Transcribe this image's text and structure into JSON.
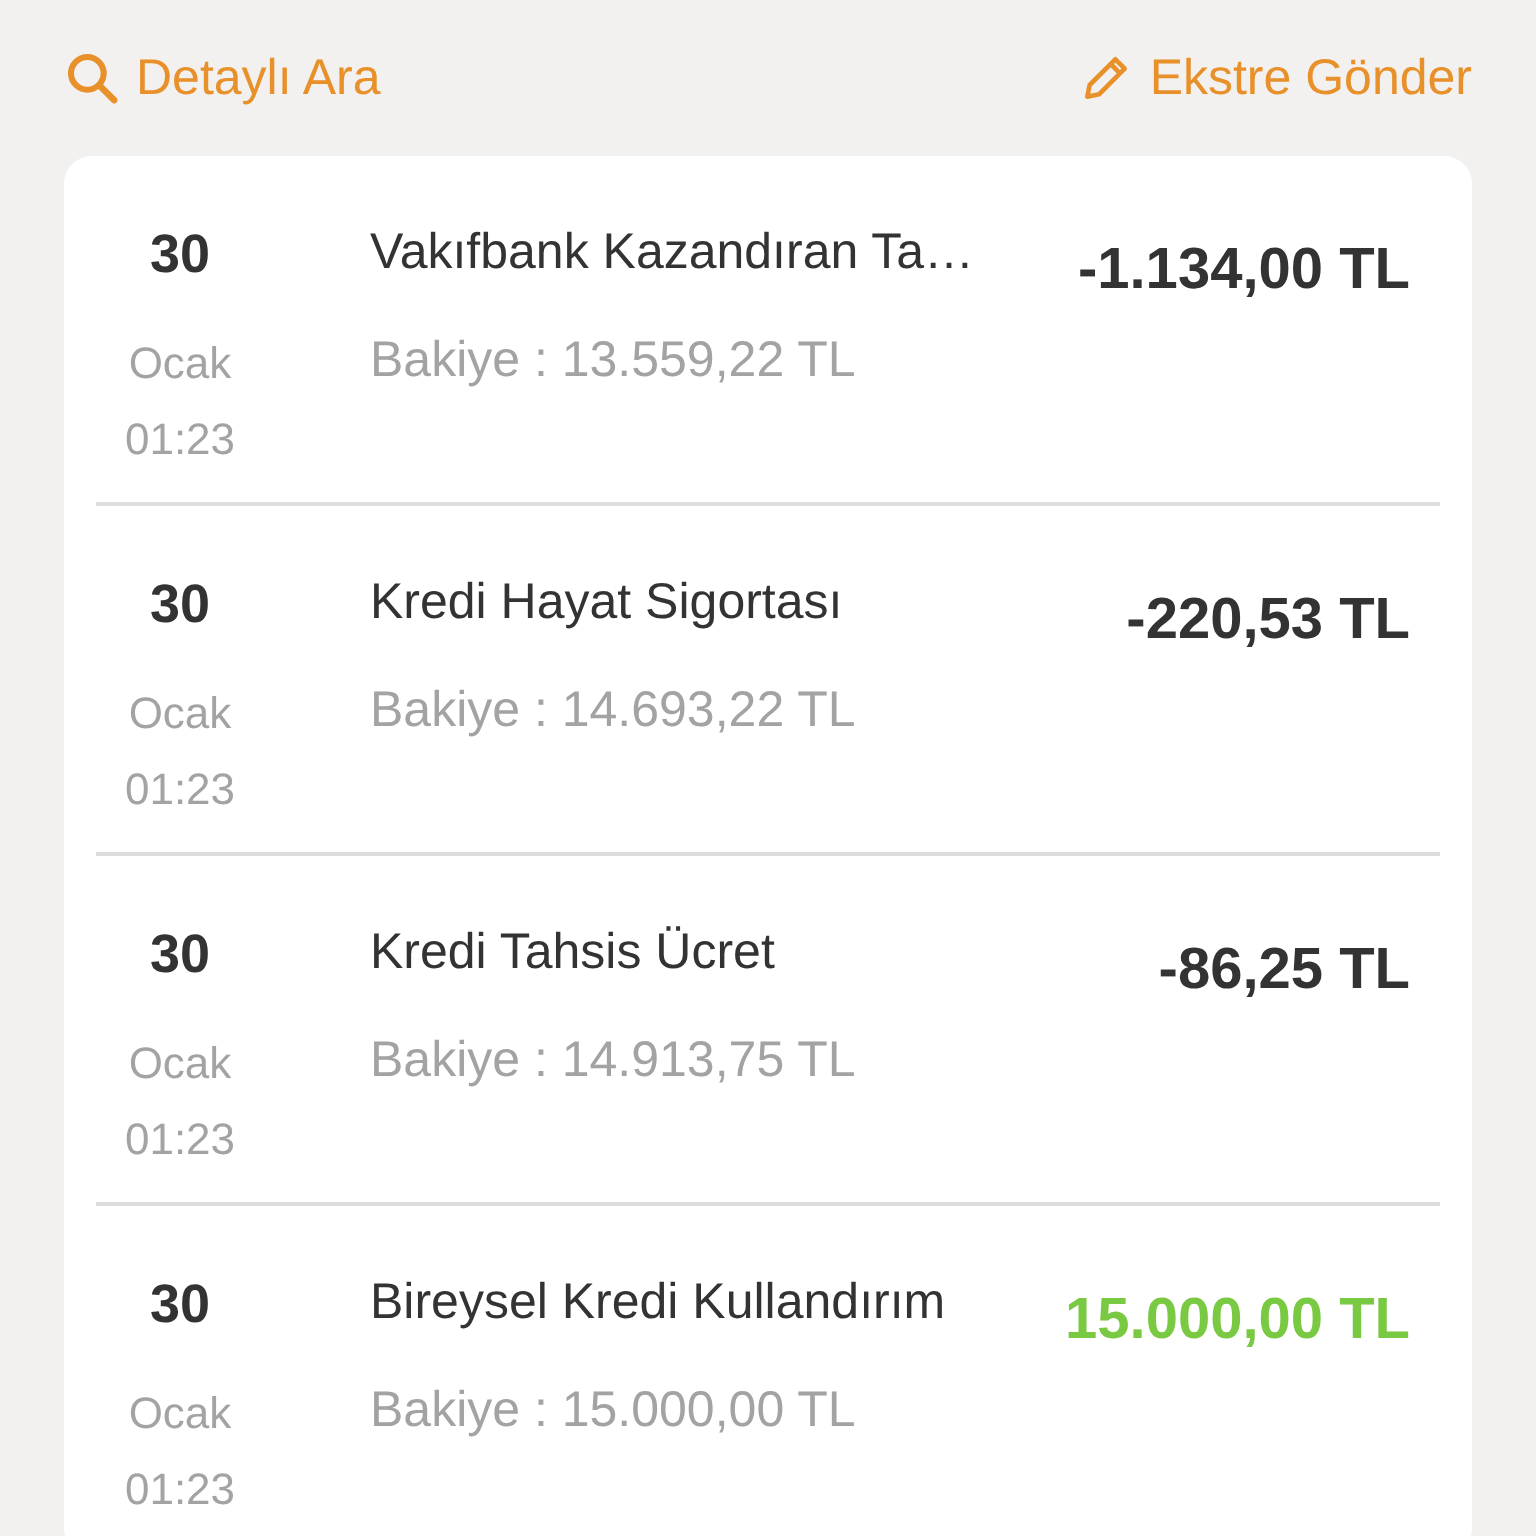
{
  "toolbar": {
    "search_link": "Detaylı Ara",
    "statement_link": "Ekstre Gönder"
  },
  "transactions": [
    {
      "day": "30",
      "month": "Ocak",
      "time": "01:23",
      "title": "Vakıfbank Kazandıran Ta…",
      "balance": "Bakiye : 13.559,22 TL",
      "amount": "-1.134,00 TL",
      "kind": "debit"
    },
    {
      "day": "30",
      "month": "Ocak",
      "time": "01:23",
      "title": "Kredi Hayat Sigortası",
      "balance": "Bakiye : 14.693,22 TL",
      "amount": "-220,53 TL",
      "kind": "debit"
    },
    {
      "day": "30",
      "month": "Ocak",
      "time": "01:23",
      "title": "Kredi Tahsis Ücret",
      "balance": "Bakiye : 14.913,75 TL",
      "amount": "-86,25 TL",
      "kind": "debit"
    },
    {
      "day": "30",
      "month": "Ocak",
      "time": "01:23",
      "title": "Bireysel Kredi Kullandırım",
      "balance": "Bakiye : 15.000,00 TL",
      "amount": "15.000,00 TL",
      "kind": "credit"
    }
  ]
}
